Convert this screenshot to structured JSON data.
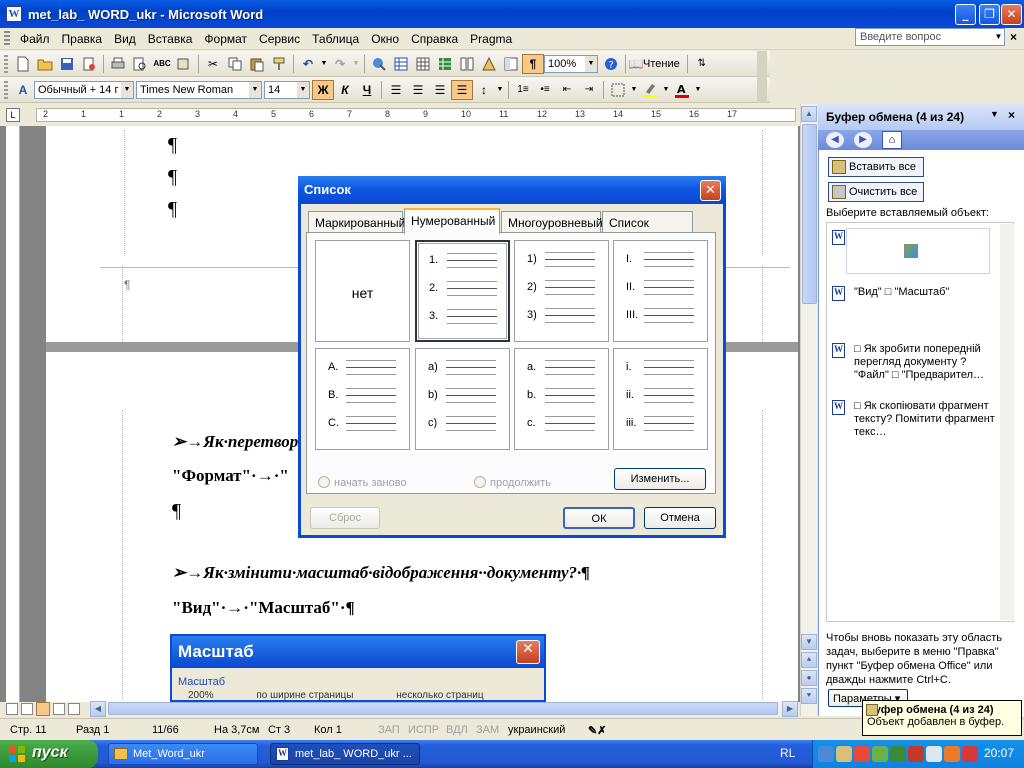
{
  "window": {
    "title": "met_lab_ WORD_ukr - Microsoft Word"
  },
  "menu": [
    "Файл",
    "Правка",
    "Вид",
    "Вставка",
    "Формат",
    "Сервис",
    "Таблица",
    "Окно",
    "Справка",
    "Pragma"
  ],
  "ask_placeholder": "Введите вопрос",
  "toolbar": {
    "zoom": "100%",
    "read_label": "Чтение",
    "style": "Обычный + 14 г",
    "font": "Times New Roman",
    "size": "14",
    "bold": "Ж",
    "italic": "К",
    "underline": "Ч"
  },
  "ruler": {
    "marks": [
      "2",
      "1",
      "1",
      "2",
      "3",
      "4",
      "5",
      "6",
      "7",
      "8",
      "9",
      "10",
      "11",
      "12",
      "13",
      "14",
      "15",
      "16",
      "17"
    ]
  },
  "document": {
    "pilcrow": "¶",
    "heading1": "➢→Як·перетвор",
    "cmd1": "\"Формат\"·→·\"",
    "heading2": "➢→Як·змінити·масштаб·відображення··документу?·¶",
    "cmd2": "\"Вид\"·→·\"Масштаб\"·¶",
    "mini_dialog": {
      "title": "Масштаб",
      "group": "Масштаб",
      "options": [
        "200%",
        "по ширине страницы",
        "несколько страниц"
      ]
    }
  },
  "dialog": {
    "title": "Список",
    "tabs": [
      "Маркированный",
      "Нумерованный",
      "Многоуровневый",
      "Список стилей"
    ],
    "active_tab": 1,
    "none_label": "нет",
    "grid": [
      [
        "1.",
        "2.",
        "3."
      ],
      [
        "1)",
        "2)",
        "3)"
      ],
      [
        "I.",
        "II.",
        "III."
      ],
      [
        "A.",
        "B.",
        "C."
      ],
      [
        "a)",
        "b)",
        "c)"
      ],
      [
        "a.",
        "b.",
        "c."
      ],
      [
        "i.",
        "ii.",
        "iii."
      ]
    ],
    "radio_restart": "начать заново",
    "radio_continue": "продолжить",
    "modify_btn": "Изменить...",
    "reset_btn": "Сброс",
    "ok_btn": "ОК",
    "cancel_btn": "Отмена"
  },
  "taskpane": {
    "title": "Буфер обмена (4 из 24)",
    "paste_all": "Вставить все",
    "clear_all": "Очистить все",
    "choose_label": "Выберите вставляемый объект:",
    "items": [
      {
        "text": "\"Вид\" □ \"Масштаб\""
      },
      {
        "text": "□ Як зробити попередній перегляд документу ? \"Файл\" □ \"Предварител…"
      },
      {
        "text": "□ Як скопіювати фрагмент тексту? Помітити фрагмент текс…"
      }
    ],
    "footer": "Чтобы вновь показать эту область задач, выберите в меню \"Правка\" пункт \"Буфер обмена Office\" или дважды нажмите Ctrl+C.",
    "options_btn": "Параметры"
  },
  "status": {
    "page": "Стр. 11",
    "section": "Разд 1",
    "pages": "11/66",
    "at": "На 3,7см",
    "line": "Ст 3",
    "col": "Кол 1",
    "rec": "ЗАП",
    "trk": "ИСПР",
    "ext": "ВДЛ",
    "ovr": "ЗАМ",
    "lang": "украинский"
  },
  "balloon": {
    "title": "Буфер обмена (4 из 24)",
    "text": "Объект добавлен в буфер."
  },
  "taskbar": {
    "start": "пуск",
    "tasks": [
      "Met_Word_ukr",
      "met_lab_ WORD_ukr ..."
    ],
    "lang": "RL",
    "clock": "20:07"
  },
  "colors": {
    "xp_blue": "#0a5ee6",
    "start_green": "#3c9a3c",
    "highlight": "#f6c98b"
  }
}
